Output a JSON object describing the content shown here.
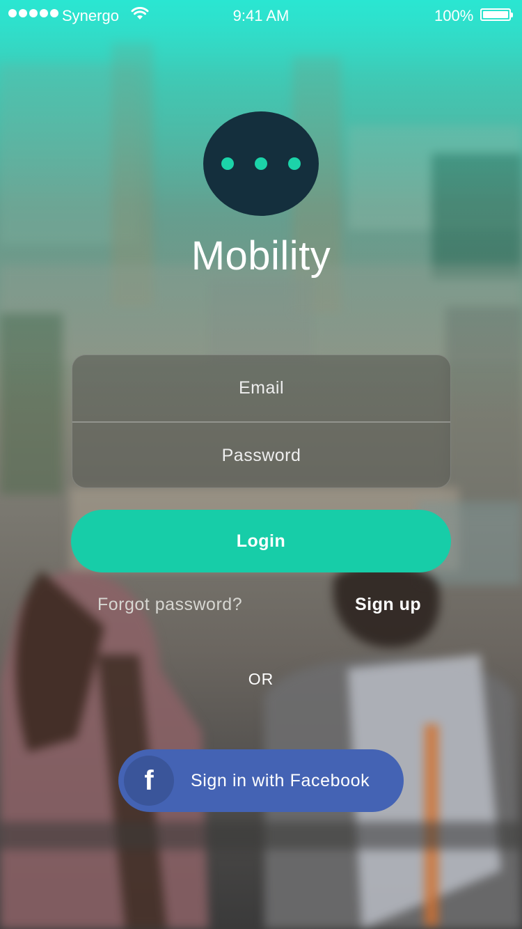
{
  "status_bar": {
    "carrier": "Synergo",
    "time": "9:41 AM",
    "battery": "100%"
  },
  "app": {
    "title": "Mobility"
  },
  "login_form": {
    "email_placeholder": "Email",
    "password_placeholder": "Password",
    "login_label": "Login"
  },
  "links": {
    "forgot_password": "Forgot password?",
    "sign_up": "Sign up"
  },
  "separator": "OR",
  "facebook": {
    "icon_glyph": "f",
    "label": "Sign in with Facebook"
  },
  "colors": {
    "accent": "#17cda8",
    "logo_bg": "#142f3d",
    "facebook_blue": "#4463b4"
  },
  "icons": {
    "status": [
      "signal-dots-icon",
      "wifi-icon",
      "battery-icon"
    ],
    "logo": "chat-bubble-icon",
    "social": "facebook-icon"
  }
}
